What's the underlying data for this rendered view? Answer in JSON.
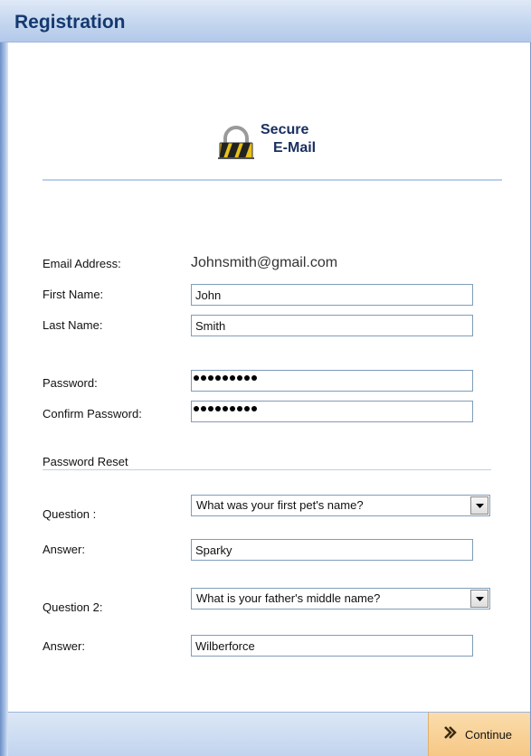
{
  "window": {
    "title": "Registration"
  },
  "logo": {
    "line1": "Secure",
    "line2": "E-Mail",
    "icon": "padlock-icon"
  },
  "form": {
    "email_label": "Email Address:",
    "email_value": "Johnsmith@gmail.com",
    "first_name_label": "First Name:",
    "first_name_value": "John",
    "last_name_label": "Last Name:",
    "last_name_value": "Smith",
    "password_label": "Password:",
    "password_mask_count": 9,
    "confirm_password_label": "Confirm Password:",
    "confirm_password_mask_count": 9
  },
  "password_reset": {
    "section_title": "Password Reset",
    "question1_label": "Question :",
    "question1_value": "What was your first pet's name?",
    "answer1_label": "Answer:",
    "answer1_value": "Sparky",
    "question2_label": "Question 2:",
    "question2_value": "What is your father's middle name?",
    "answer2_label": "Answer:",
    "answer2_value": "Wilberforce"
  },
  "footer": {
    "continue_label": "Continue",
    "continue_icon": "double-chevron-right-icon"
  },
  "colors": {
    "title_text": "#15386f",
    "titlebar_bg": "#c4d6ef",
    "continue_bg": "#f8cf96",
    "divider": "#bcd0ec"
  }
}
